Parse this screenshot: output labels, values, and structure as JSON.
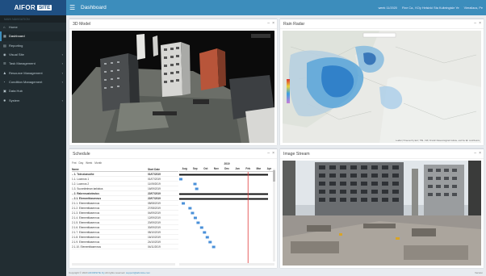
{
  "app": {
    "logo_text": "AIFOR",
    "logo_box": "SITE",
    "page_title": "Dashboard"
  },
  "sidebar": {
    "header": "MAIN NAVIGATION",
    "items": [
      {
        "label": "Home",
        "icon": "home-icon",
        "glyph": "⌂",
        "chevron": ""
      },
      {
        "label": "Dashboard",
        "icon": "dashboard-icon",
        "glyph": "▦",
        "chevron": ""
      },
      {
        "label": "Reporting",
        "icon": "chart-icon",
        "glyph": "▤",
        "chevron": ""
      },
      {
        "label": "Visual Site",
        "icon": "eye-icon",
        "glyph": "◉",
        "chevron": "‹"
      },
      {
        "label": "Task Management",
        "icon": "tasks-icon",
        "glyph": "☰",
        "chevron": "‹"
      },
      {
        "label": "Resource Management",
        "icon": "user-icon",
        "glyph": "♟",
        "chevron": "‹"
      },
      {
        "label": "Condition Management",
        "icon": "gauge-icon",
        "glyph": "◔",
        "chevron": "‹"
      },
      {
        "label": "Data Hub",
        "icon": "database-icon",
        "glyph": "▣",
        "chevron": ""
      },
      {
        "label": "System",
        "icon": "gear-icon",
        "glyph": "✹",
        "chevron": "‹"
      }
    ]
  },
  "topbar": {
    "menu_icon": "☰",
    "week": "week 11/2020",
    "weather": "Fine Ca., KOy Helsinki Sta Kuiteingisle Ye",
    "user": "Vierailaus, Pe"
  },
  "panels": {
    "model": {
      "title": "3D Model"
    },
    "radar": {
      "title": "Rain Radar",
      "credit": "Leaflet | Powered by Esri | HSL, FMI, Finnish Meteorological Institute, and the EU contributors"
    },
    "schedule": {
      "title": "Schedule"
    },
    "stream": {
      "title": "Image Stream"
    }
  },
  "panel_tools": {
    "minimize": "–",
    "close": "×"
  },
  "schedule": {
    "toolbar": [
      "Fmt",
      "Day",
      "Week",
      "Month"
    ],
    "col_name": "Name",
    "col_start": "Start Date",
    "year": "2019",
    "months": [
      "Aug",
      "Sep",
      "Oct",
      "Nov",
      "Dec",
      "Jan",
      "Feb",
      "Mar",
      "Apr"
    ],
    "rows": [
      {
        "name": "– 1. Toteutusvaihe",
        "date": "01/07/2019",
        "bold": true
      },
      {
        "name": "1.1. Luonnos 1",
        "date": "01/07/2019",
        "bold": false
      },
      {
        "name": "1.2. Luonnos 2",
        "date": "11/09/2019",
        "bold": false
      },
      {
        "name": "1.3. Suunnitelman tarkistus",
        "date": "16/09/2019",
        "bold": false
      },
      {
        "name": "– 2. Rakennustoteutus",
        "date": "22/07/2019",
        "bold": true
      },
      {
        "name": "– 2.1. Elementtiasennus",
        "date": "22/07/2019",
        "bold": true
      },
      {
        "name": "2.1.1. Elementtiasennus",
        "date": "08/08/2019",
        "bold": false
      },
      {
        "name": "2.1.2. Elementtiasennus",
        "date": "27/08/2019",
        "bold": false
      },
      {
        "name": "2.1.3. Elementtiasennus",
        "date": "04/09/2019",
        "bold": false
      },
      {
        "name": "2.1.4. Elementtiasennus",
        "date": "12/09/2019",
        "bold": false
      },
      {
        "name": "2.1.5. Elementtiasennus",
        "date": "20/09/2019",
        "bold": false
      },
      {
        "name": "2.1.6. Elementtiasennus",
        "date": "30/09/2019",
        "bold": false
      },
      {
        "name": "2.1.7. Elementtiasennus",
        "date": "08/10/2019",
        "bold": false
      },
      {
        "name": "2.1.8. Elementtiasennus",
        "date": "16/10/2019",
        "bold": false
      },
      {
        "name": "2.1.9. Elementtiasennus",
        "date": "24/10/2019",
        "bold": false
      },
      {
        "name": "2.1.10. Elementtiasennus",
        "date": "04/11/2019",
        "bold": false
      }
    ]
  },
  "footer": {
    "copyright": "Copyright © 2020",
    "company": "AIFORSITE Oy",
    "rights": "All rights reserved.",
    "email": "support@aiforsite.com",
    "version": "Version"
  },
  "colors": {
    "topbar": "#3c8dbc",
    "sidebar": "#222d32",
    "bar_blue": "#4a90d9",
    "bar_black": "#111111",
    "today_line": "#e03a3a"
  }
}
